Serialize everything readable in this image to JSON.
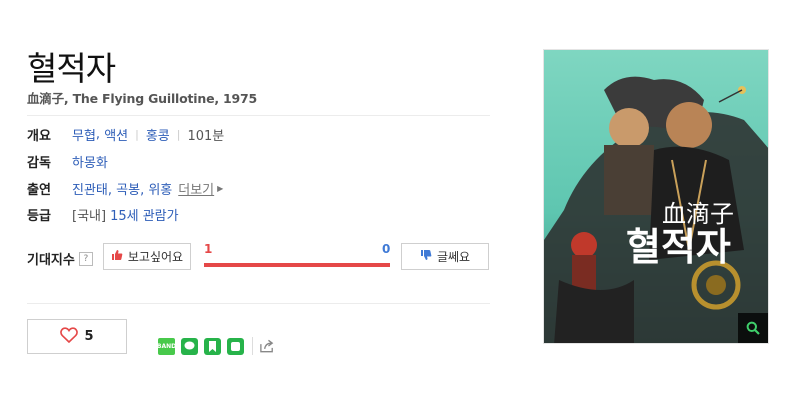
{
  "movie": {
    "title": "혈적자",
    "subtitle": "血滴子, The Flying Guillotine, 1975"
  },
  "info": {
    "overview": {
      "label": "개요",
      "genres": [
        "무협",
        "액션"
      ],
      "country": "홍콩",
      "runtime": "101분"
    },
    "director": {
      "label": "감독",
      "name": "하몽화"
    },
    "cast": {
      "label": "출연",
      "names": "진관태, 곡봉, 위홍",
      "more": "더보기"
    },
    "rating": {
      "label": "등급",
      "region": "[국내]",
      "value": "15세 관람가"
    }
  },
  "expectation": {
    "label": "기대지수",
    "help_icon": "?",
    "want_label": "보고싶어요",
    "dislike_label": "글쎄요",
    "want_count": "1",
    "dislike_count": "0",
    "want_fraction": 1.0,
    "colors": {
      "want": "#e54848",
      "dislike": "#3f7ad6"
    }
  },
  "like": {
    "count": "5",
    "icon": "heart-outline-icon"
  },
  "share": {
    "icons": [
      "band-icon",
      "line-icon",
      "bookmark-icon",
      "blog-icon",
      "share-arrow-icon"
    ],
    "band_text": "BAND"
  },
  "poster": {
    "title_hanja": "血滴子",
    "title_hangul": "혈적자",
    "zoom_icon": "magnifier-icon",
    "accent_color": "#5ec6b0"
  }
}
